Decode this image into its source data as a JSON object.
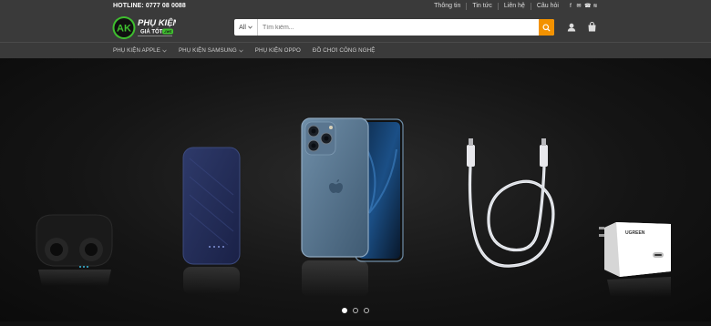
{
  "topbar": {
    "hotline": "HOTLINE: 0777 08 0088",
    "links": [
      "Thông tin",
      "Tin tức",
      "Liên hệ",
      "Câu hỏi"
    ],
    "social_icons": [
      "facebook-icon",
      "mail-icon",
      "phone-icon",
      "rss-icon"
    ]
  },
  "logo": {
    "monogram": "AK",
    "line1": "PHỤ KIỆN",
    "line2": "GIÁ TỐT",
    "badge": ".net"
  },
  "search": {
    "category": "All",
    "placeholder": "Tìm kiếm..."
  },
  "header_icons": [
    "user-icon",
    "cart-icon"
  ],
  "nav": {
    "items": [
      {
        "label": "PHỤ KIỆN APPLE",
        "has_dropdown": true
      },
      {
        "label": "PHỤ KIỆN SAMSUNG",
        "has_dropdown": true
      },
      {
        "label": "PHỤ KIỆN OPPO",
        "has_dropdown": false
      },
      {
        "label": "ĐỒ CHƠI CÔNG NGHỆ",
        "has_dropdown": false
      }
    ]
  },
  "hero": {
    "products": [
      "earbuds",
      "power-bank",
      "iphone-12-pro",
      "usb-c-cable",
      "ugreen-charger"
    ],
    "charger_brand": "UGREEN",
    "slide_count": 3,
    "active_slide": 1
  },
  "colors": {
    "bar": "#3a3a3a",
    "accent": "#f39200",
    "logo_green": "#3fbf2f"
  }
}
